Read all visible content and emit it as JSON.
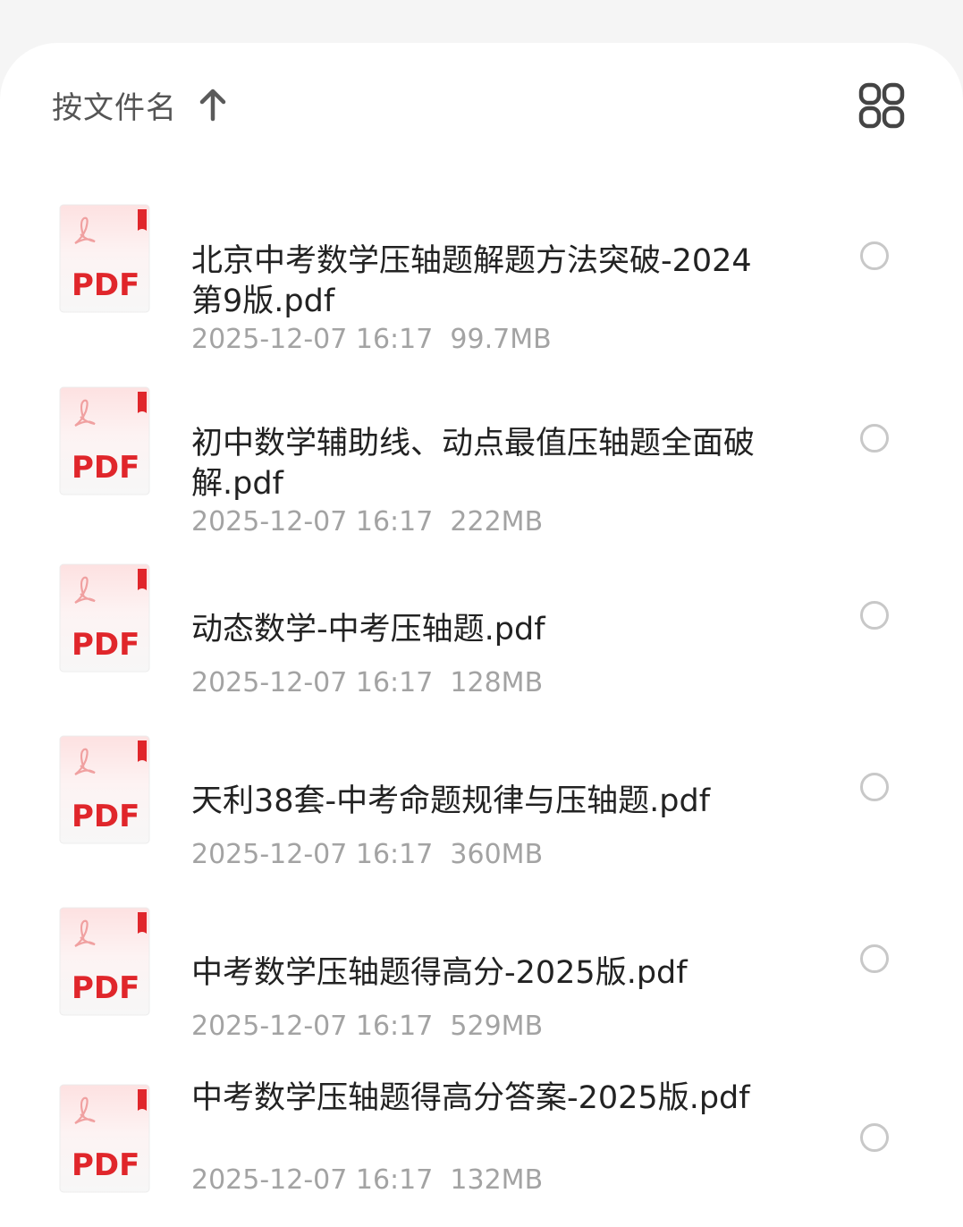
{
  "toolbar": {
    "sort_label": "按文件名",
    "sort_icon": "arrow-up-icon",
    "view_icon": "grid-view-icon"
  },
  "colors": {
    "pdf_red": "#e0262b",
    "text_primary": "#222222",
    "text_secondary": "#a3a3a3"
  },
  "files": [
    {
      "name": "北京中考数学压轴题解题方法突破-2024第9版.pdf",
      "date": "2025-12-07 16:17",
      "size": "99.7MB",
      "icon_label": "PDF"
    },
    {
      "name": "初中数学辅助线、动点最值压轴题全面破解.pdf",
      "date": "2025-12-07 16:17",
      "size": "222MB",
      "icon_label": "PDF"
    },
    {
      "name": "动态数学-中考压轴题.pdf",
      "date": "2025-12-07 16:17",
      "size": "128MB",
      "icon_label": "PDF"
    },
    {
      "name": "天利38套-中考命题规律与压轴题.pdf",
      "date": "2025-12-07 16:17",
      "size": "360MB",
      "icon_label": "PDF"
    },
    {
      "name": "中考数学压轴题得高分-2025版.pdf",
      "date": "2025-12-07 16:17",
      "size": "529MB",
      "icon_label": "PDF"
    },
    {
      "name": "中考数学压轴题得高分答案-2025版.pdf",
      "date": "2025-12-07 16:17",
      "size": "132MB",
      "icon_label": "PDF"
    }
  ]
}
